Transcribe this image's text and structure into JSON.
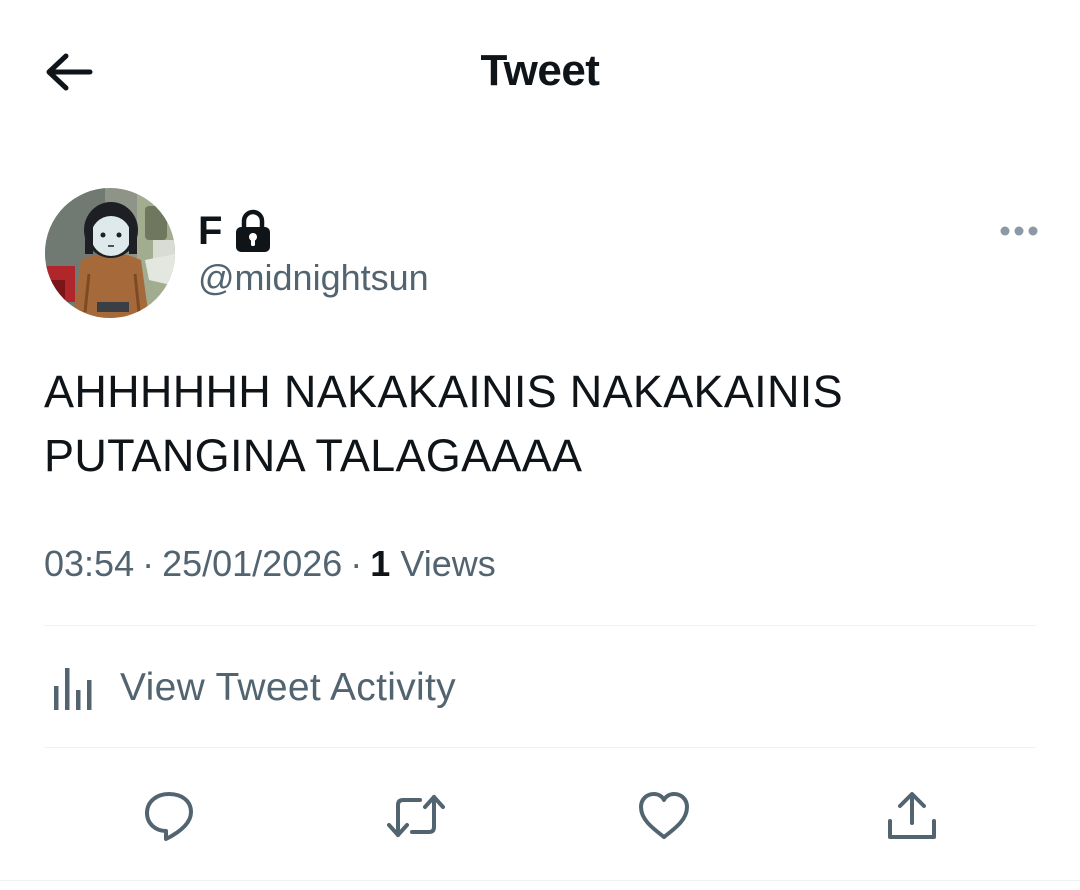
{
  "header": {
    "title": "Tweet",
    "back_icon": "arrow-left-icon"
  },
  "author": {
    "display_name": "F",
    "handle": "@midnightsun",
    "protected_icon": "lock-icon",
    "avatar_icon": "avatar-cartoon-girl"
  },
  "tweet": {
    "text": "AHHHHHH NAKAKAINIS NAKAKAINIS\nPUTANGINA TALAGAAAA",
    "time": "03:54",
    "date": "25/01/2026",
    "views_count": "1",
    "views_label": "Views",
    "separator": "·"
  },
  "activity": {
    "label": "View Tweet Activity",
    "icon": "bar-chart-icon"
  },
  "actions": {
    "reply_icon": "reply-icon",
    "retweet_icon": "retweet-icon",
    "like_icon": "heart-icon",
    "share_icon": "share-icon",
    "more_icon": "more-horizontal-icon"
  },
  "colors": {
    "text_primary": "#0f1419",
    "text_secondary": "#536471",
    "divider": "#eff3f4",
    "more_dots": "#8b98a5"
  }
}
